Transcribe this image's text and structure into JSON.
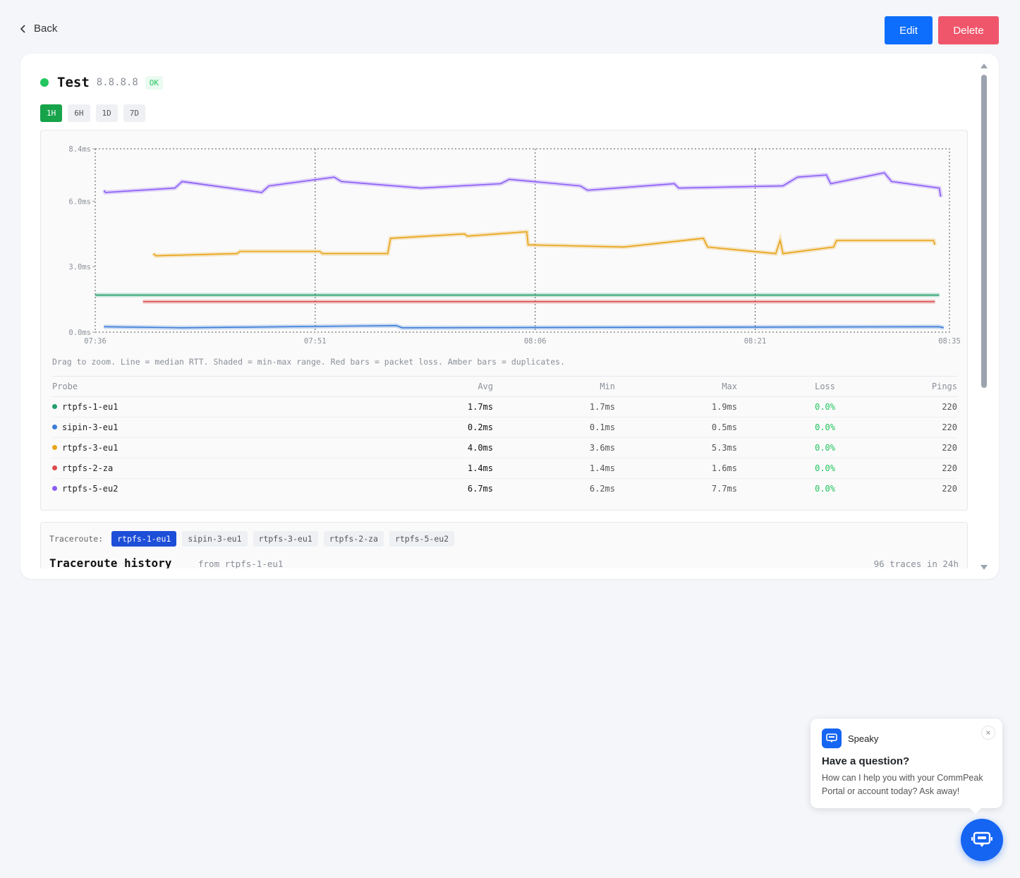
{
  "nav": {
    "back_label": "Back",
    "edit_label": "Edit",
    "delete_label": "Delete"
  },
  "monitor": {
    "name": "Test",
    "host": "8.8.8.8",
    "status": "OK",
    "status_color": "#22c55e"
  },
  "ranges": [
    {
      "label": "1H",
      "active": true
    },
    {
      "label": "6H",
      "active": false
    },
    {
      "label": "1D",
      "active": false
    },
    {
      "label": "7D",
      "active": false
    }
  ],
  "chart_note": "Drag to zoom. Line = median RTT. Shaded = min-max range. Red bars = packet loss. Amber bars = duplicates.",
  "chart_data": {
    "type": "line",
    "y_tick_labels": [
      "8.4ms",
      "6.0ms",
      "3.0ms",
      "0.0ms"
    ],
    "y_ticks": [
      8.4,
      6.0,
      3.0,
      0.0
    ],
    "x_tick_labels": [
      "07:36",
      "07:51",
      "08:06",
      "08:21",
      "08:35"
    ],
    "ylim": [
      0,
      8.4
    ],
    "series": [
      {
        "name": "rtpfs-5-eu2",
        "color": "#8b5cf6",
        "points": [
          [
            0.6,
            6.5
          ],
          [
            0.7,
            6.4
          ],
          [
            5.5,
            6.6
          ],
          [
            6.0,
            6.9
          ],
          [
            11.5,
            6.4
          ],
          [
            12.0,
            6.7
          ],
          [
            16.5,
            7.1
          ],
          [
            17.0,
            6.9
          ],
          [
            22.5,
            6.6
          ],
          [
            28.0,
            6.8
          ],
          [
            28.6,
            7.0
          ],
          [
            33.5,
            6.7
          ],
          [
            34.0,
            6.5
          ],
          [
            40.0,
            6.8
          ],
          [
            40.3,
            6.6
          ],
          [
            47.5,
            6.7
          ],
          [
            48.5,
            7.1
          ],
          [
            50.5,
            7.2
          ],
          [
            50.8,
            6.8
          ],
          [
            54.5,
            7.3
          ],
          [
            55.0,
            6.9
          ],
          [
            58.3,
            6.6
          ],
          [
            58.4,
            6.2
          ]
        ]
      },
      {
        "name": "rtpfs-3-eu1",
        "color": "#e8a317",
        "points": [
          [
            4.0,
            3.6
          ],
          [
            4.2,
            3.5
          ],
          [
            9.8,
            3.6
          ],
          [
            10.0,
            3.7
          ],
          [
            15.5,
            3.7
          ],
          [
            15.7,
            3.6
          ],
          [
            20.2,
            3.6
          ],
          [
            20.4,
            4.3
          ],
          [
            25.5,
            4.5
          ],
          [
            25.7,
            4.4
          ],
          [
            29.8,
            4.6
          ],
          [
            29.9,
            4.0
          ],
          [
            36.5,
            3.9
          ],
          [
            42.0,
            4.3
          ],
          [
            42.3,
            3.9
          ],
          [
            47.0,
            3.6
          ],
          [
            47.3,
            4.2
          ],
          [
            47.5,
            3.6
          ],
          [
            51.0,
            3.9
          ],
          [
            51.2,
            4.2
          ],
          [
            57.9,
            4.2
          ],
          [
            58.0,
            4.0
          ]
        ]
      },
      {
        "name": "rtpfs-1-eu1",
        "color": "#22a06b",
        "points": [
          [
            0.0,
            1.7
          ],
          [
            58.3,
            1.7
          ]
        ]
      },
      {
        "name": "rtpfs-2-za",
        "color": "#dc4b4b",
        "points": [
          [
            3.3,
            1.4
          ],
          [
            58.0,
            1.4
          ]
        ]
      },
      {
        "name": "sipin-3-eu1",
        "color": "#3b7dd8",
        "points": [
          [
            0.6,
            0.25
          ],
          [
            6.0,
            0.2
          ],
          [
            20.8,
            0.3
          ],
          [
            21.2,
            0.2
          ],
          [
            58.3,
            0.25
          ],
          [
            58.6,
            0.2
          ]
        ]
      }
    ]
  },
  "stats": {
    "headers": {
      "probe": "Probe",
      "avg": "Avg",
      "min": "Min",
      "max": "Max",
      "loss": "Loss",
      "pings": "Pings"
    },
    "rows": [
      {
        "probe": "rtpfs-1-eu1",
        "color": "#22a06b",
        "avg": "1.7ms",
        "min": "1.7ms",
        "max": "1.9ms",
        "loss": "0.0%",
        "pings": "220"
      },
      {
        "probe": "sipin-3-eu1",
        "color": "#3b7dd8",
        "avg": "0.2ms",
        "min": "0.1ms",
        "max": "0.5ms",
        "loss": "0.0%",
        "pings": "220"
      },
      {
        "probe": "rtpfs-3-eu1",
        "color": "#e8a317",
        "avg": "4.0ms",
        "min": "3.6ms",
        "max": "5.3ms",
        "loss": "0.0%",
        "pings": "220"
      },
      {
        "probe": "rtpfs-2-za",
        "color": "#dc4b4b",
        "avg": "1.4ms",
        "min": "1.4ms",
        "max": "1.6ms",
        "loss": "0.0%",
        "pings": "220"
      },
      {
        "probe": "rtpfs-5-eu2",
        "color": "#8b5cf6",
        "avg": "6.7ms",
        "min": "6.2ms",
        "max": "7.7ms",
        "loss": "0.0%",
        "pings": "220"
      }
    ]
  },
  "traceroute": {
    "label": "Traceroute:",
    "tabs": [
      {
        "label": "rtpfs-1-eu1",
        "active": true
      },
      {
        "label": "sipin-3-eu1",
        "active": false
      },
      {
        "label": "rtpfs-3-eu1",
        "active": false
      },
      {
        "label": "rtpfs-2-za",
        "active": false
      },
      {
        "label": "rtpfs-5-eu2",
        "active": false
      }
    ],
    "title": "Traceroute history",
    "from": "from rtpfs-1-eu1",
    "count": "96 traces in 24h"
  },
  "chat": {
    "name": "Speaky",
    "question": "Have a question?",
    "body": "How can I help you with your CommPeak Portal or account today? Ask away!",
    "accent": "#1565f2"
  }
}
